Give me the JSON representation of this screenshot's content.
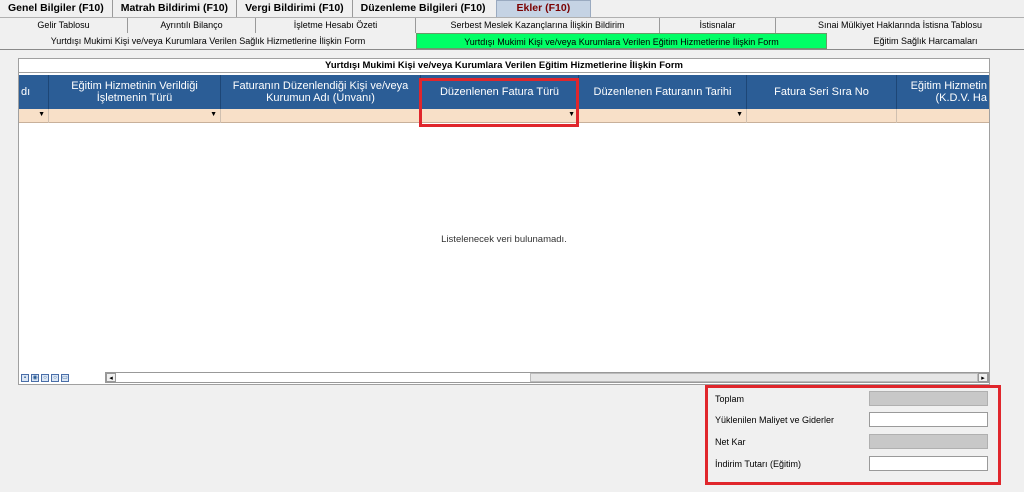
{
  "main_tabs": [
    {
      "label": "Genel Bilgiler (F10)"
    },
    {
      "label": "Matrah Bildirimi (F10)"
    },
    {
      "label": "Vergi Bildirimi (F10)"
    },
    {
      "label": "Düzenleme Bilgileri  (F10)"
    },
    {
      "label": "Ekler (F10)"
    }
  ],
  "sub_tabs_row1": [
    {
      "label": "Gelir Tablosu"
    },
    {
      "label": "Ayrıntılı Bilanço"
    },
    {
      "label": "İşletme Hesabı Özeti"
    },
    {
      "label": "Serbest Meslek Kazançlarına İlişkin Bildirim"
    },
    {
      "label": "İstisnalar"
    },
    {
      "label": "Sınai Mülkiyet Haklarında İstisna Tablosu"
    }
  ],
  "sub_tabs_row2": [
    {
      "label": "Yurtdışı Mukimi Kişi ve/veya Kurumlara Verilen Sağlık Hizmetlerine İlişkin Form"
    },
    {
      "label": "Yurtdışı Mukimi Kişi ve/veya Kurumlara Verilen Eğitim Hizmetlerine İlişkin Form"
    },
    {
      "label": "Eğitim Sağlık Harcamaları"
    }
  ],
  "panel": {
    "title": "Yurtdışı Mukimi Kişi ve/veya Kurumlara Verilen Eğitim Hizmetlerine İlişkin Form",
    "columns": [
      {
        "l1": "dı",
        "l2": ""
      },
      {
        "l1": "Eğitim Hizmetinin Verildiği",
        "l2": "İşletmenin Türü"
      },
      {
        "l1": "Faturanın Düzenlendiği Kişi ve/veya",
        "l2": "Kurumun Adı (Unvanı)"
      },
      {
        "l1": "Düzenlenen Fatura Türü",
        "l2": ""
      },
      {
        "l1": "Düzenlenen Faturanın Tarihi",
        "l2": ""
      },
      {
        "l1": "Fatura Seri Sıra No",
        "l2": ""
      },
      {
        "l1": "Eğitim Hizmetin",
        "l2": "(K.D.V. Ha"
      }
    ],
    "empty_message": "Listelenecek veri bulunamadı."
  },
  "totals": {
    "toplam_label": "Toplam",
    "maliyet_label": "Yüklenilen Maliyet ve Giderler",
    "netkar_label": "Net Kar",
    "indirim_label": "İndirim Tutarı (Eğitim)"
  },
  "colors": {
    "header_bg": "#2b5d96",
    "active_subtab": "#00ff66",
    "filter_bg": "#f8e0c8",
    "highlight": "#e0262c"
  }
}
